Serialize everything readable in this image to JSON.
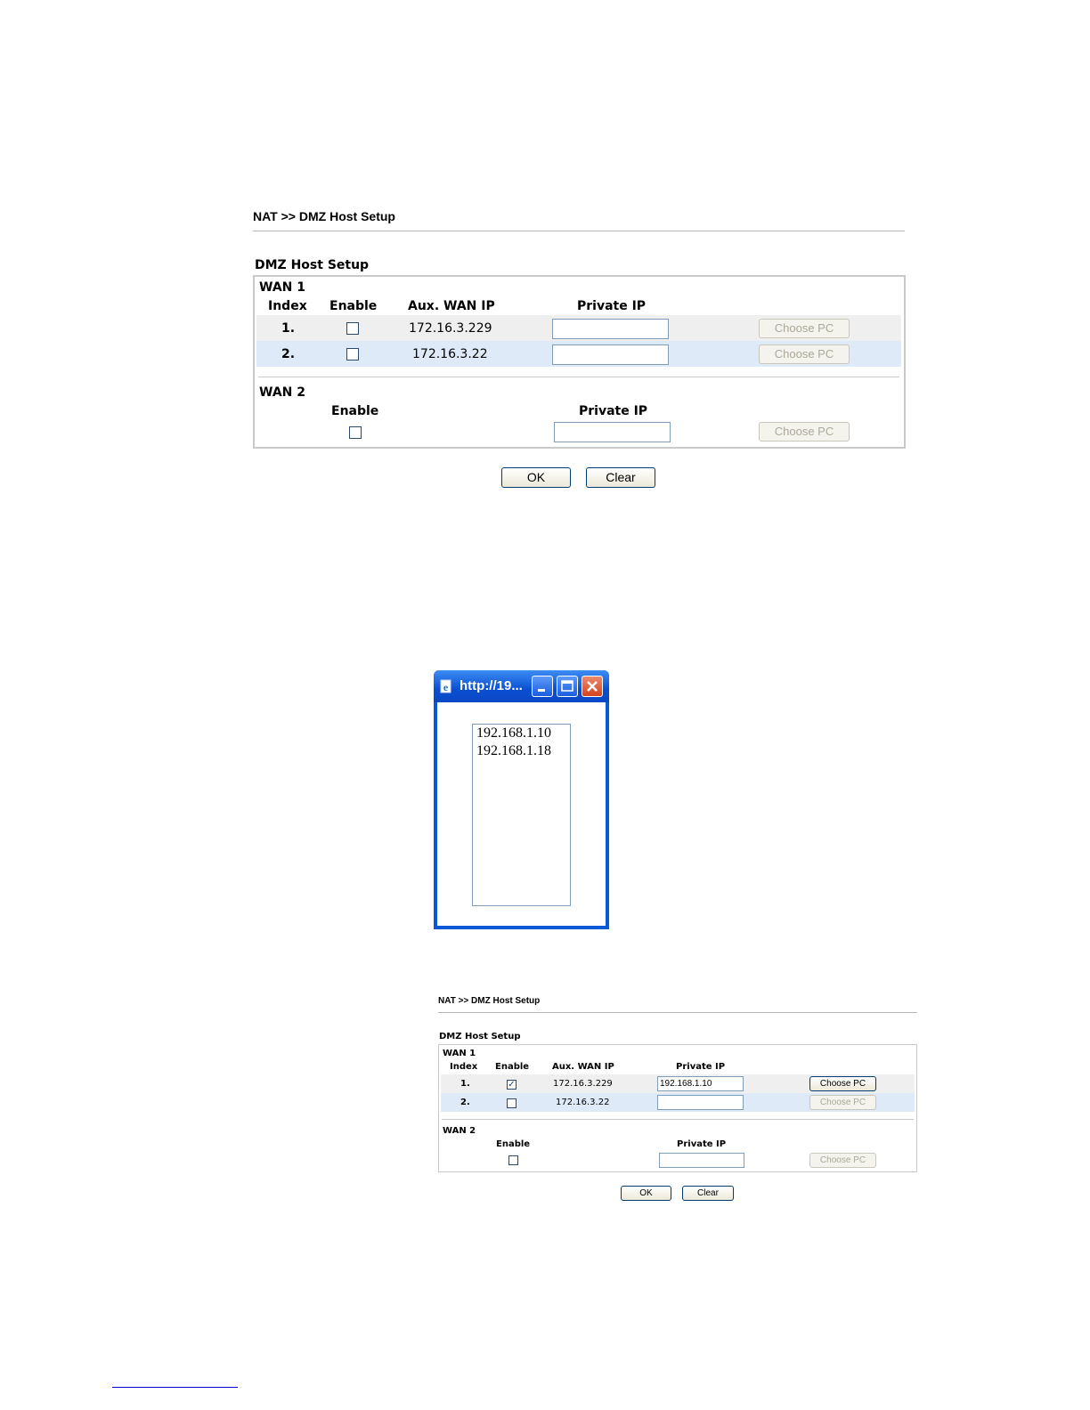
{
  "panel1": {
    "breadcrumb": "NAT >> DMZ Host Setup",
    "section_title": "DMZ Host Setup",
    "wan1": {
      "label": "WAN 1",
      "headers": {
        "index": "Index",
        "enable": "Enable",
        "aux_wan_ip": "Aux. WAN IP",
        "private_ip": "Private IP"
      },
      "rows": [
        {
          "index": "1.",
          "enabled": false,
          "aux_wan_ip": "172.16.3.229",
          "private_ip": "",
          "choose_pc": "Choose PC",
          "choose_pc_enabled": false
        },
        {
          "index": "2.",
          "enabled": false,
          "aux_wan_ip": "172.16.3.22",
          "private_ip": "",
          "choose_pc": "Choose PC",
          "choose_pc_enabled": false
        }
      ]
    },
    "wan2": {
      "label": "WAN 2",
      "headers": {
        "enable": "Enable",
        "private_ip": "Private IP"
      },
      "enabled": false,
      "private_ip": "",
      "choose_pc": "Choose PC",
      "choose_pc_enabled": false
    },
    "ok_label": "OK",
    "clear_label": "Clear"
  },
  "popup": {
    "title": "http://19...",
    "items": [
      "192.168.1.10",
      "192.168.1.18"
    ]
  },
  "panel2": {
    "breadcrumb": "NAT >> DMZ Host Setup",
    "section_title": "DMZ Host Setup",
    "wan1": {
      "label": "WAN 1",
      "headers": {
        "index": "Index",
        "enable": "Enable",
        "aux_wan_ip": "Aux. WAN IP",
        "private_ip": "Private IP"
      },
      "rows": [
        {
          "index": "1.",
          "enabled": true,
          "aux_wan_ip": "172.16.3.229",
          "private_ip": "192.168.1.10",
          "choose_pc": "Choose PC",
          "choose_pc_enabled": true
        },
        {
          "index": "2.",
          "enabled": false,
          "aux_wan_ip": "172.16.3.22",
          "private_ip": "",
          "choose_pc": "Choose PC",
          "choose_pc_enabled": false
        }
      ]
    },
    "wan2": {
      "label": "WAN 2",
      "headers": {
        "enable": "Enable",
        "private_ip": "Private IP"
      },
      "enabled": false,
      "private_ip": "",
      "choose_pc": "Choose PC",
      "choose_pc_enabled": false
    },
    "ok_label": "OK",
    "clear_label": "Clear"
  },
  "colors": {
    "row_gray": "#efefef",
    "row_blue": "#dfeaf8",
    "window_blue": "#0a5ad8",
    "close_red": "#d6431e"
  },
  "icons": [
    "ie-page-icon",
    "minimize-icon",
    "maximize-icon",
    "close-icon",
    "checkmark-icon"
  ]
}
